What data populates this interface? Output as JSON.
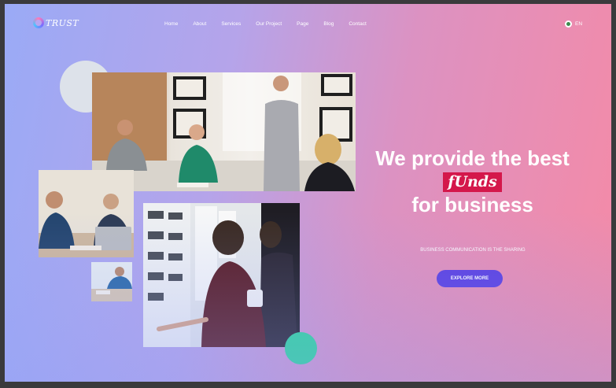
{
  "brand": {
    "logo_text": "TRUST"
  },
  "nav": {
    "items": [
      "Home",
      "About",
      "Services",
      "Our Project",
      "Page",
      "Blog",
      "Contact"
    ]
  },
  "lang": {
    "label": "EN"
  },
  "hero": {
    "line1": "We provide the best",
    "highlight": "fUnds",
    "line3": "for business",
    "subtitle": "BUSINESS COMMUNICATION IS THE SHARING",
    "cta": "EXPLORE MORE"
  },
  "colors": {
    "cta": "#5b3fe0",
    "highlight": "#d4174b",
    "accent_circle": "#2fd69a"
  }
}
